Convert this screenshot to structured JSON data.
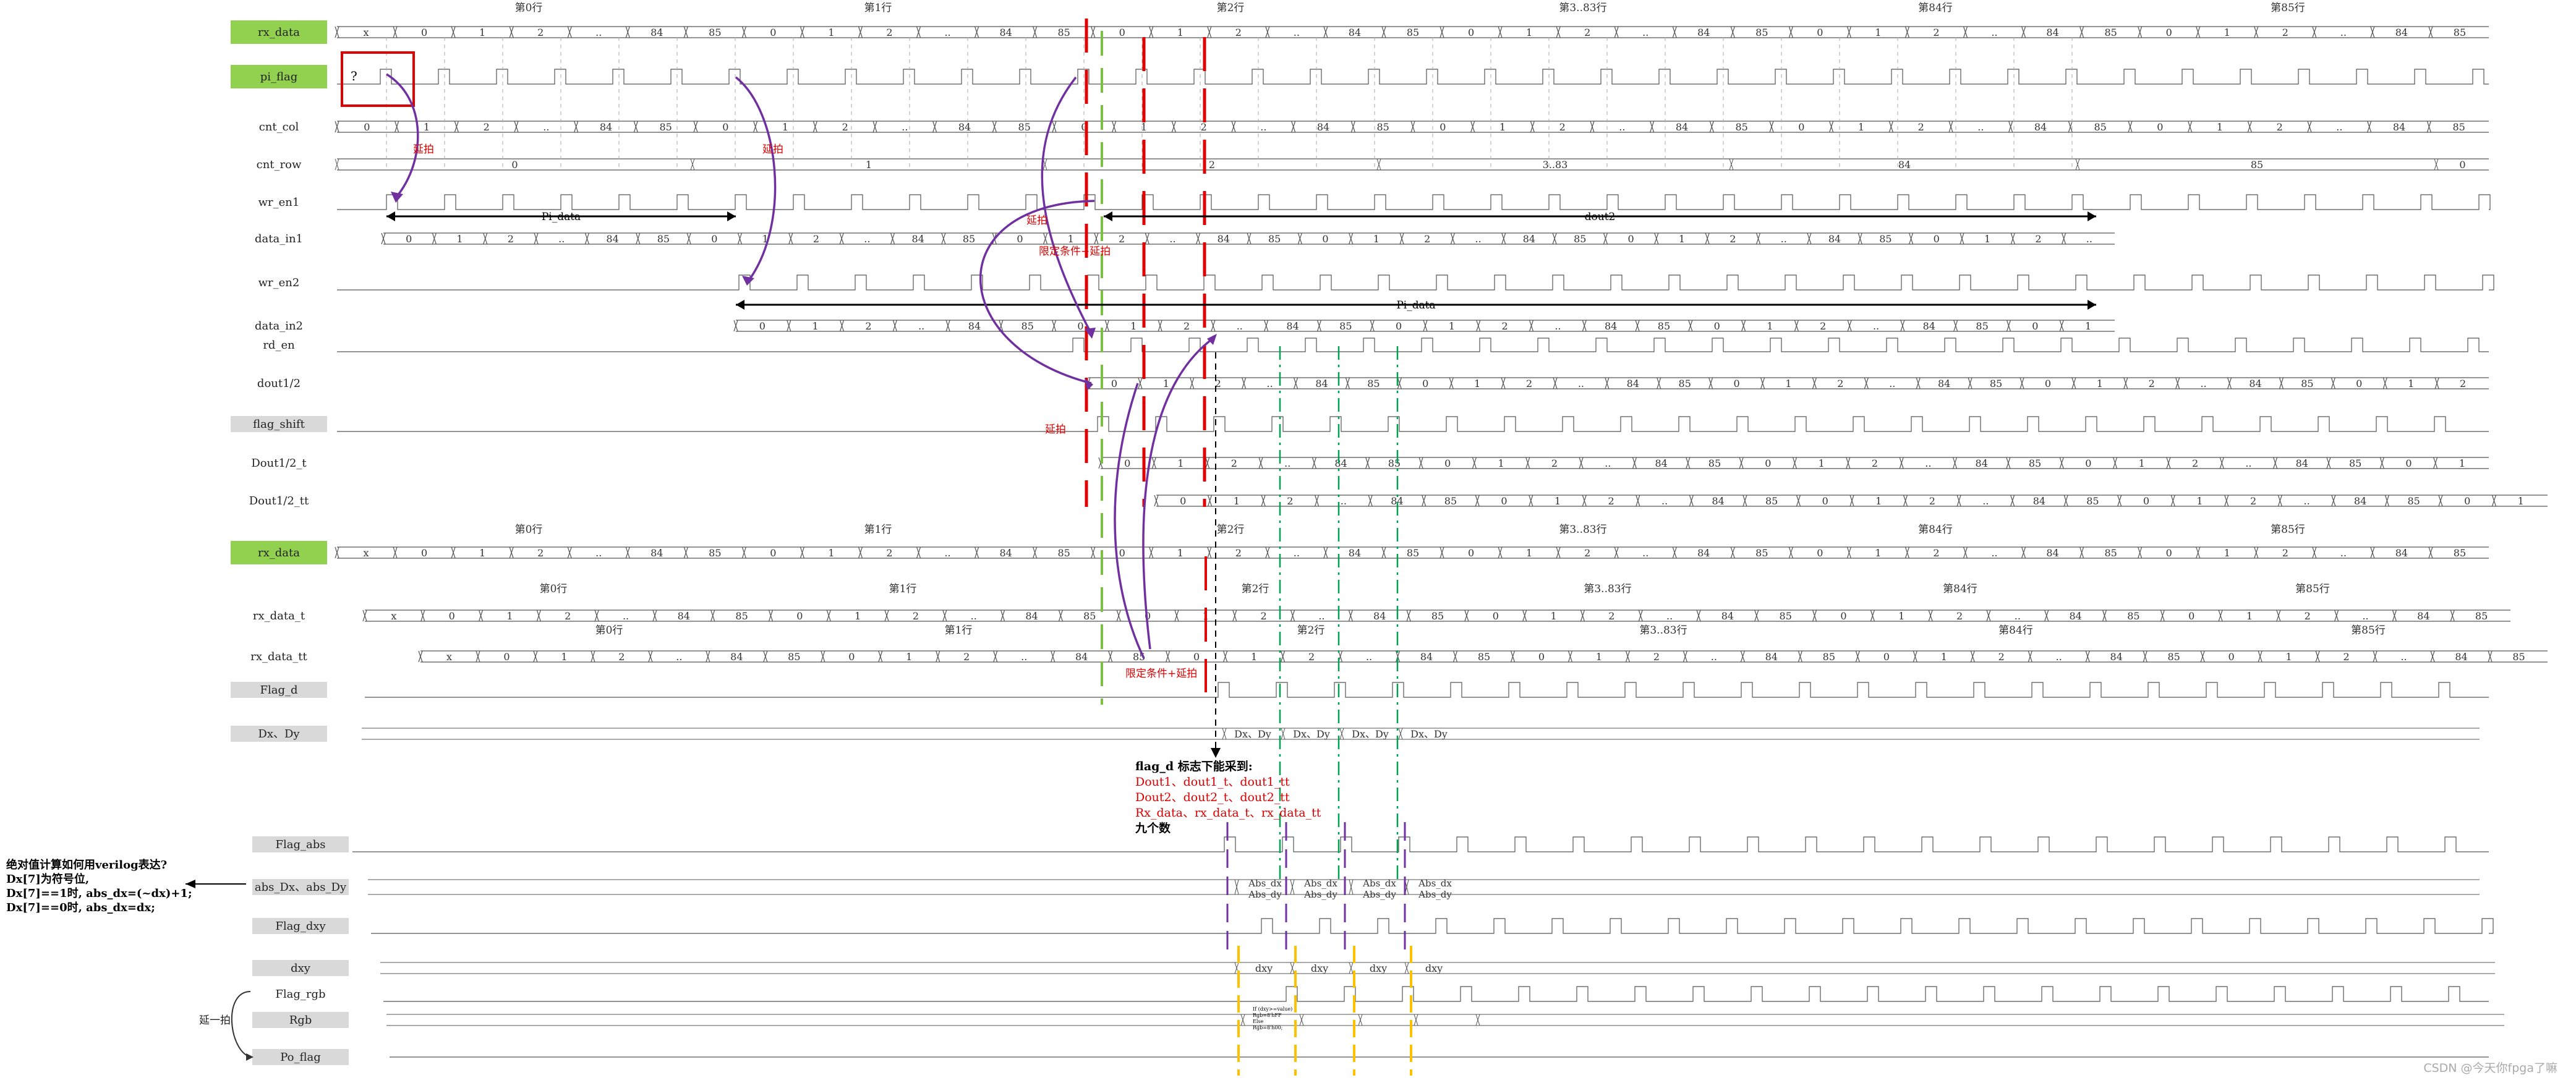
{
  "rows": [
    {
      "name": "rx_data",
      "box": "green"
    },
    {
      "name": "pi_flag",
      "box": "green"
    },
    {
      "name": "cnt_col",
      "box": "none"
    },
    {
      "name": "cnt_row",
      "box": "none"
    },
    {
      "name": "wr_en1",
      "box": "none"
    },
    {
      "name": "data_in1",
      "box": "none"
    },
    {
      "name": "wr_en2",
      "box": "none"
    },
    {
      "name": "data_in2",
      "box": "none"
    },
    {
      "name": "rd_en",
      "box": "none"
    },
    {
      "name": "dout1/2",
      "box": "none"
    },
    {
      "name": "flag_shift",
      "box": "gray"
    },
    {
      "name": "Dout1/2_t",
      "box": "none"
    },
    {
      "name": "Dout1/2_tt",
      "box": "none"
    },
    {
      "name": "rx_data",
      "box": "green"
    },
    {
      "name": "rx_data_t",
      "box": "none"
    },
    {
      "name": "rx_data_tt",
      "box": "none"
    },
    {
      "name": "Flag_d",
      "box": "gray"
    },
    {
      "name": "Dx、Dy",
      "box": "gray"
    },
    {
      "name": "Flag_abs",
      "box": "gray"
    },
    {
      "name": "abs_Dx、abs_Dy",
      "box": "gray"
    },
    {
      "name": "Flag_dxy",
      "box": "gray"
    },
    {
      "name": "dxy",
      "box": "gray"
    },
    {
      "name": "Flag_rgb",
      "box": "none"
    },
    {
      "name": "Rgb",
      "box": "gray"
    },
    {
      "name": "Po_flag",
      "box": "gray"
    }
  ],
  "seq_values": [
    "0",
    "1",
    "2",
    "..",
    "84",
    "85"
  ],
  "row_headers": [
    "第0行",
    "第1行",
    "第2行",
    "第3..83行",
    "第84行",
    "第85行"
  ],
  "cnt_row_values": [
    "0",
    "1",
    "2",
    "3..83",
    "84",
    "85",
    "0"
  ],
  "x_label": "x",
  "pi_question": "?",
  "arrows": {
    "pi_data": "Pi_data",
    "dout2": "dout2"
  },
  "red_notes": {
    "delay": "延拍",
    "delay_cond": "限定条件+延拍"
  },
  "pair_labels": {
    "dx_dy": "Dx、Dy",
    "abs_dx": "Abs_dx",
    "abs_dy": "Abs_dy",
    "dxy": "dxy"
  },
  "flag_d_note": {
    "title": "flag_d 标志下能采到:",
    "lines": [
      "Dout1、dout1_t、dout1_tt",
      "Dout2、dout2_t、dout2_tt",
      "Rx_data、rx_data_t、rx_data_tt"
    ],
    "footer": "九个数"
  },
  "abs_note": [
    "绝对值计算如何用verilog表达?",
    "Dx[7]为符号位,",
    "Dx[7]==1时, abs_dx=(~dx)+1;",
    "Dx[7]==0时, abs_dx=dx;"
  ],
  "delay_one": "延一拍",
  "rgb_annotation": [
    "If (dxy>=value)",
    "Rgb=8'hFF",
    "Else",
    "Rgb=8'h00;"
  ],
  "watermark": "CSDN @今天你fpga了嘛",
  "colors": {
    "green": "#92d050",
    "gray": "#d9d9d9",
    "red": "#e00000",
    "purple": "#7030a0",
    "dgreen": "#00a050",
    "orange": "#ffc000"
  }
}
